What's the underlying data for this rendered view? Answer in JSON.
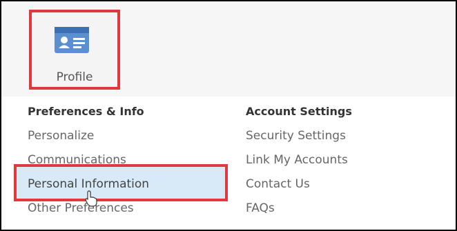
{
  "profile": {
    "label": "Profile",
    "icon": "id-card-icon",
    "accent": "#4a90d9"
  },
  "preferences": {
    "title": "Preferences & Info",
    "items": [
      "Personalize",
      "Communications",
      "Personal Information",
      "Other Preferences"
    ]
  },
  "account": {
    "title": "Account Settings",
    "items": [
      "Security Settings",
      "Link My Accounts",
      "Contact Us",
      "FAQs"
    ]
  },
  "highlight_color": "#e2373c",
  "hover_bg": "#d8e9f7"
}
